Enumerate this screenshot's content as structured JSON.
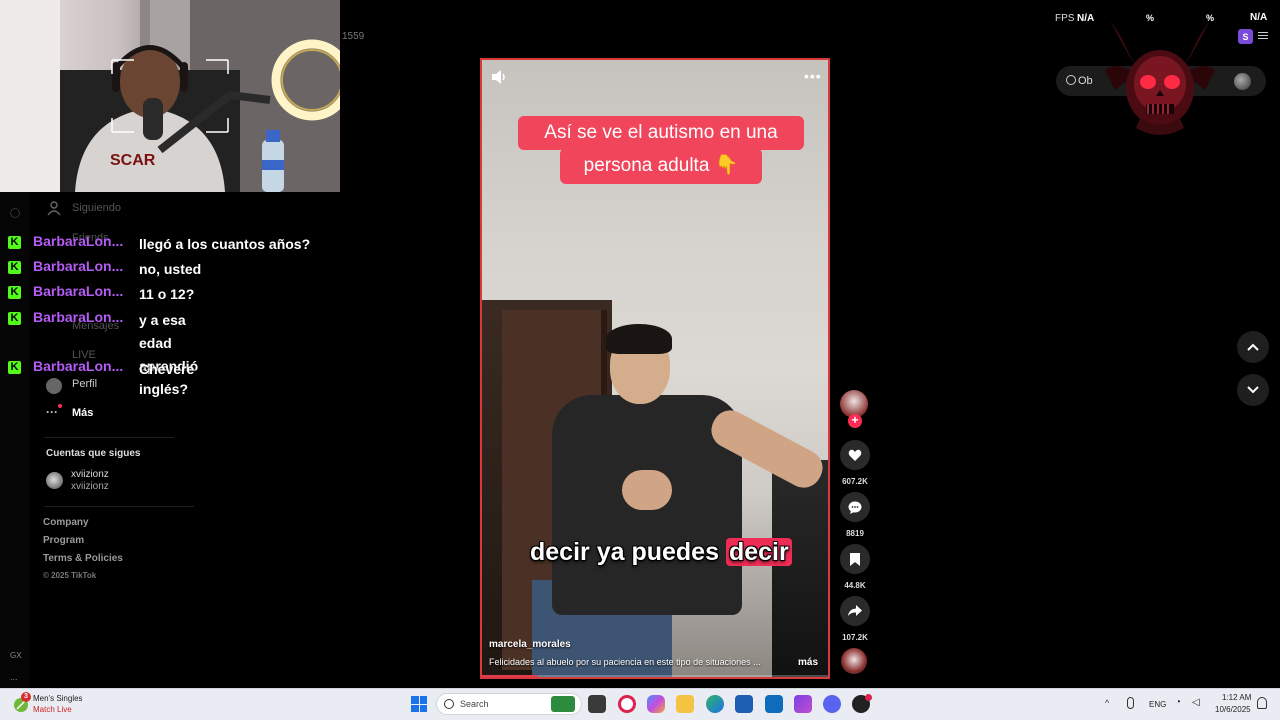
{
  "topbar": {
    "count": "1559",
    "fps_label": "FPS",
    "fps_value": "N/A",
    "hud_pct1": "%",
    "hud_pct2": "%",
    "hud_na": "N/A",
    "profile_badge": "S",
    "coins_label": "Ob"
  },
  "sidebar": {
    "items": [
      {
        "label": "Siguiendo",
        "icon": "user-icon"
      },
      {
        "label": "Friends",
        "icon": "friends-icon"
      },
      {
        "label": "Mensajes",
        "icon": "send-icon"
      },
      {
        "label": "LIVE",
        "icon": "live-icon"
      },
      {
        "label": "Perfil",
        "icon": "profile-icon"
      },
      {
        "label": "Más",
        "icon": "more-icon"
      }
    ],
    "following_title": "Cuentas que sigues",
    "following": [
      {
        "name": "xviizionz",
        "handle": "xviizionz"
      }
    ],
    "footer": [
      "Company",
      "Program",
      "Terms & Policies"
    ],
    "copyright": "© 2025 TikTok"
  },
  "gx": {
    "label": "GX",
    "more": "..."
  },
  "chat": {
    "platform_icon": "kick-icon",
    "accent_user": "#b45cf6",
    "accent_platform": "#52fb18",
    "messages": [
      {
        "user": "BarbaraLon...",
        "text": "llegó a los cuantos años?"
      },
      {
        "user": "BarbaraLon...",
        "text": "no, usted"
      },
      {
        "user": "BarbaraLon...",
        "text": "11 o 12?"
      },
      {
        "user": "BarbaraLon...",
        "text": "y a esa edad aprendió\ninglés?"
      },
      {
        "user": "BarbaraLon...",
        "text": "Chevere"
      }
    ]
  },
  "video": {
    "caption_line1": "Así se ve el autismo en una",
    "caption_line2": "persona adulta 👇",
    "subtitle_main": "decir ya puedes ",
    "subtitle_highlight": "decir",
    "author": "marcela_morales",
    "description": "Felicidades al abuelo por su paciencia en este tipo de situaciones ...",
    "more_label": "más",
    "progress": 0.16,
    "border_color": "#d83a3a"
  },
  "actions": {
    "likes": "607.2K",
    "comments": "8819",
    "saves": "44.8K",
    "shares": "107.2K"
  },
  "taskbar": {
    "news_title": "Men's Singles",
    "news_sub": "Match Live",
    "weather_badge": "3",
    "search_label": "Search",
    "lang": "ENG",
    "time": "1:12 AM",
    "date": "10/6/2025",
    "apps": [
      "file-icon",
      "opera-gx-icon",
      "copilot-icon",
      "folder-icon",
      "edge-icon",
      "store-icon",
      "outlook-icon",
      "clipchamp-icon",
      "discord-icon",
      "app-icon"
    ]
  }
}
